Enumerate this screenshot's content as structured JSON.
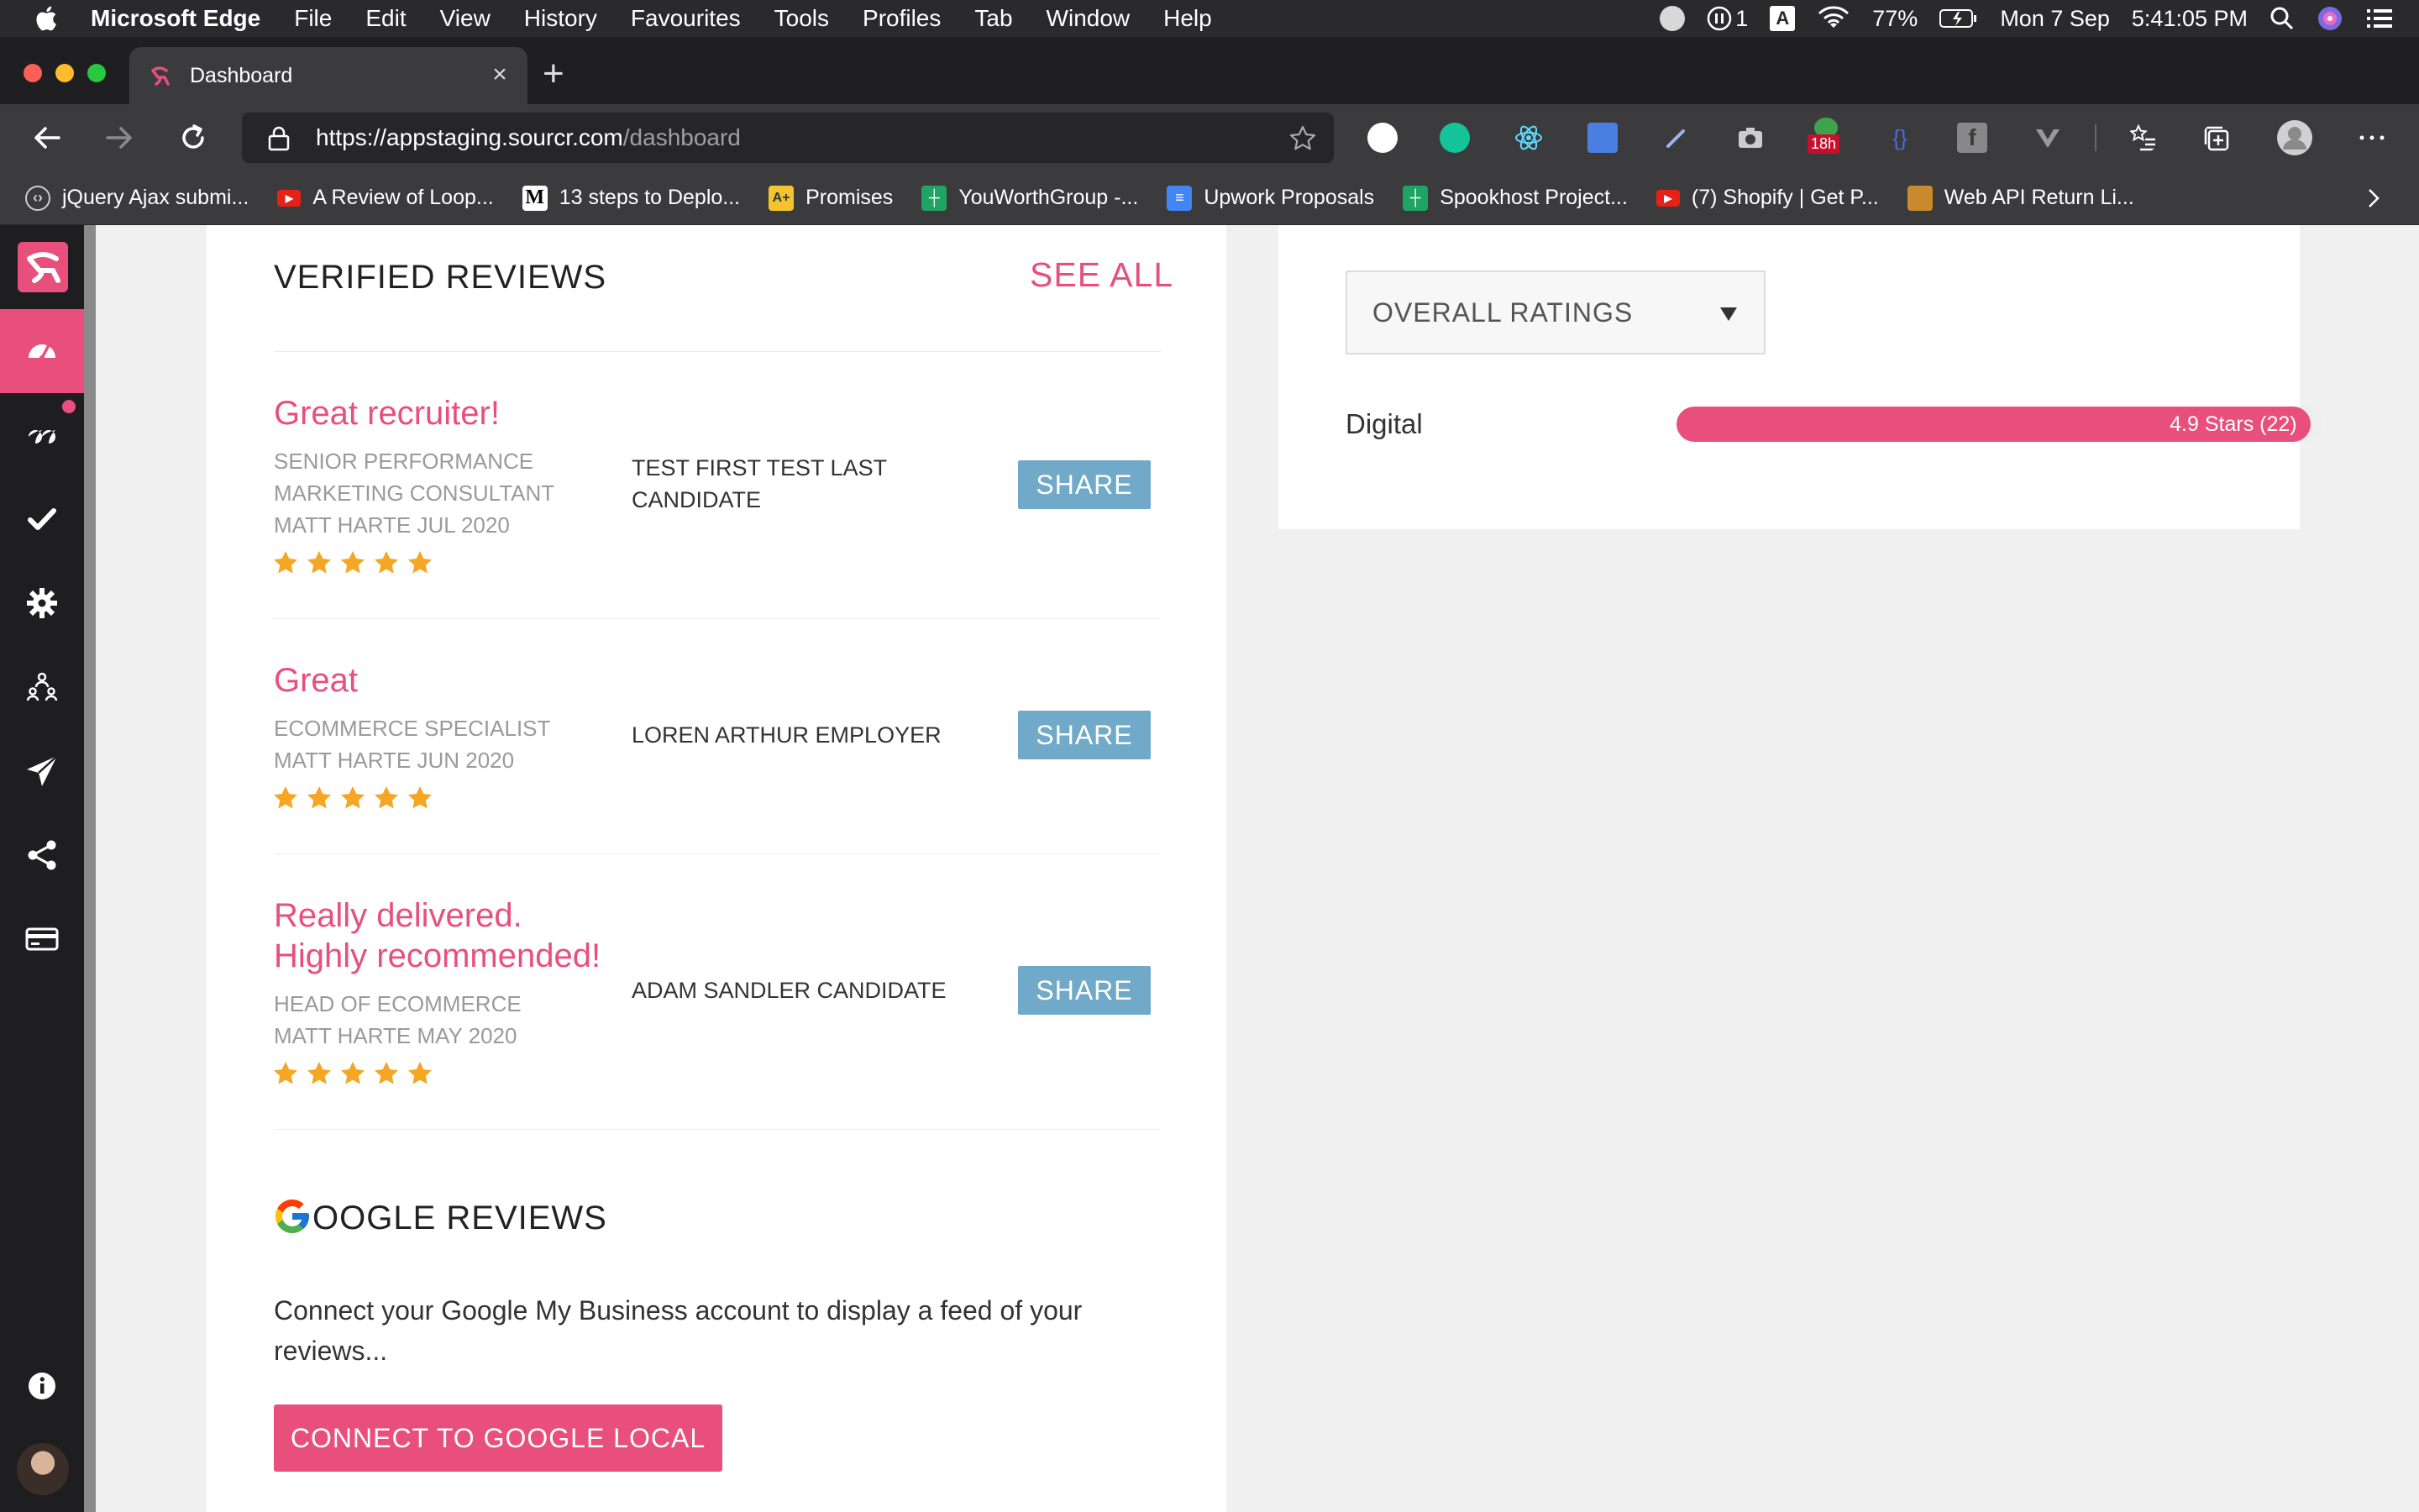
{
  "menubar": {
    "app_name": "Microsoft Edge",
    "items": [
      "File",
      "Edit",
      "View",
      "History",
      "Favourites",
      "Tools",
      "Profiles",
      "Tab",
      "Window",
      "Help"
    ],
    "status": {
      "one_count": "1",
      "box_letter": "A",
      "battery": "77%",
      "date": "Mon 7 Sep",
      "time": "5:41:05 PM"
    }
  },
  "browser": {
    "tab_title": "Dashboard",
    "url": {
      "scheme": "https://",
      "host": "appstaging.sourcr.com",
      "path": "/dashboard"
    },
    "extension_badge": "18h",
    "bookmarks": [
      {
        "label": "jQuery Ajax submi...",
        "icon": "code-icon"
      },
      {
        "label": "A Review of Loop...",
        "icon": "youtube-icon"
      },
      {
        "label": "13 steps to Deplo...",
        "icon": "medium-icon"
      },
      {
        "label": "Promises",
        "icon": "a-plus-icon"
      },
      {
        "label": "YouWorthGroup -...",
        "icon": "sheets-icon"
      },
      {
        "label": "Upwork Proposals",
        "icon": "docs-icon"
      },
      {
        "label": "Spookhost Project...",
        "icon": "sheets-icon"
      },
      {
        "label": "(7) Shopify | Get P...",
        "icon": "youtube-icon"
      },
      {
        "label": "Web API Return Li...",
        "icon": "image-icon"
      }
    ]
  },
  "verified_reviews": {
    "title": "VERIFIED REVIEWS",
    "see_all": "SEE ALL",
    "reviews": [
      {
        "title_lines": [
          "Great recruiter!"
        ],
        "meta_lines": [
          "SENIOR PERFORMANCE",
          "MARKETING CONSULTANT",
          "MATT HARTE JUL 2020"
        ],
        "person_lines": [
          "TEST FIRST TEST LAST",
          "CANDIDATE"
        ],
        "stars": 5,
        "share_label": "SHARE"
      },
      {
        "title_lines": [
          "Great"
        ],
        "meta_lines": [
          "ECOMMERCE SPECIALIST",
          "MATT HARTE JUN 2020"
        ],
        "person_lines": [
          "LOREN ARTHUR EMPLOYER"
        ],
        "stars": 5,
        "share_label": "SHARE"
      },
      {
        "title_lines": [
          "Really delivered.",
          "Highly recommended!"
        ],
        "meta_lines": [
          "HEAD OF ECOMMERCE",
          "MATT HARTE MAY 2020"
        ],
        "person_lines": [
          "ADAM SANDLER CANDIDATE"
        ],
        "stars": 5,
        "share_label": "SHARE"
      }
    ]
  },
  "google_reviews": {
    "title": "OOGLE REVIEWS",
    "description": "Connect your Google My Business account to display a feed of your reviews...",
    "connect_label": "CONNECT TO GOOGLE LOCAL"
  },
  "ratings": {
    "select_label": "OVERALL RATINGS",
    "rows": [
      {
        "label": "Digital",
        "text": "4.9 Stars (22)",
        "fill_fraction": 0.98
      }
    ]
  },
  "colors": {
    "brand_pink": "#e84f7d",
    "share_blue": "#71a9c8",
    "star_gold": "#f5a623",
    "sidebar_dark": "#1e1e20"
  },
  "sidebar": {
    "icons": [
      "dashboard-icon",
      "quote-icon",
      "checkmark-icon",
      "settings-icon",
      "team-icon",
      "send-icon",
      "share-icon",
      "card-icon",
      "info-icon"
    ]
  }
}
